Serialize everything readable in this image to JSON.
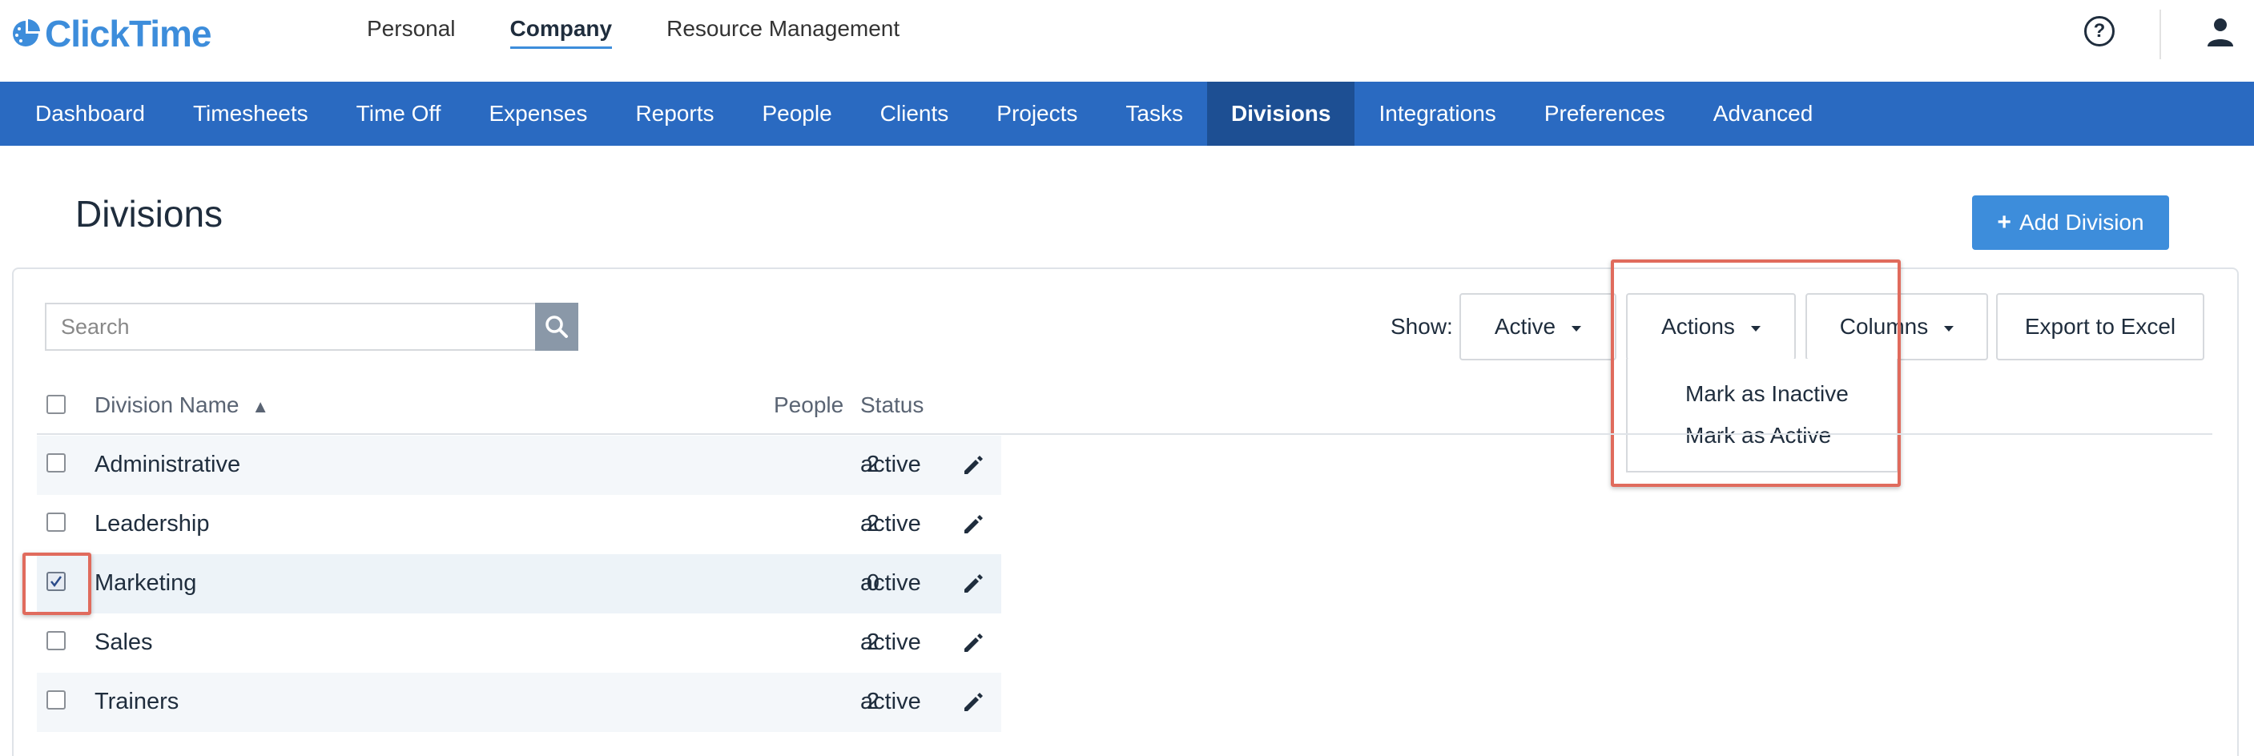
{
  "brand": {
    "name": "ClickTime"
  },
  "top_nav": [
    {
      "label": "Personal",
      "active": false
    },
    {
      "label": "Company",
      "active": true
    },
    {
      "label": "Resource Management",
      "active": false
    }
  ],
  "main_nav": [
    {
      "label": "Dashboard",
      "active": false
    },
    {
      "label": "Timesheets",
      "active": false
    },
    {
      "label": "Time Off",
      "active": false
    },
    {
      "label": "Expenses",
      "active": false
    },
    {
      "label": "Reports",
      "active": false
    },
    {
      "label": "People",
      "active": false
    },
    {
      "label": "Clients",
      "active": false
    },
    {
      "label": "Projects",
      "active": false
    },
    {
      "label": "Tasks",
      "active": false
    },
    {
      "label": "Divisions",
      "active": true
    },
    {
      "label": "Integrations",
      "active": false
    },
    {
      "label": "Preferences",
      "active": false
    },
    {
      "label": "Advanced",
      "active": false
    }
  ],
  "page": {
    "title": "Divisions",
    "add_button": "Add Division",
    "add_button_symbol": "+"
  },
  "toolbar": {
    "search_placeholder": "Search",
    "show_label": "Show:",
    "show_value": "Active",
    "actions_label": "Actions",
    "columns_label": "Columns",
    "export_label": "Export to Excel"
  },
  "actions_menu": {
    "open": true,
    "items": [
      "Mark as Inactive",
      "Mark as Active"
    ]
  },
  "table": {
    "columns": {
      "name": "Division Name",
      "sort_indicator": "▲",
      "people": "People",
      "status": "Status"
    },
    "rows": [
      {
        "name": "Administrative",
        "people": "2",
        "status": "active",
        "checked": false
      },
      {
        "name": "Leadership",
        "people": "2",
        "status": "active",
        "checked": false
      },
      {
        "name": "Marketing",
        "people": "0",
        "status": "active",
        "checked": true
      },
      {
        "name": "Sales",
        "people": "2",
        "status": "active",
        "checked": false
      },
      {
        "name": "Trainers",
        "people": "2",
        "status": "active",
        "checked": false
      }
    ]
  },
  "colors": {
    "brand_blue": "#3d8ddb",
    "nav_blue": "#2a6ac1",
    "nav_active": "#1d4f93",
    "highlight_red": "#e06b5d"
  },
  "icons": [
    "logo-icon",
    "help-icon",
    "user-icon",
    "search-icon",
    "caret-down-icon",
    "edit-icon",
    "sort-asc-icon"
  ]
}
